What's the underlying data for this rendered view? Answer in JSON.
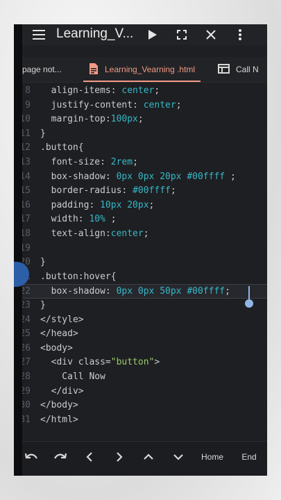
{
  "toolbar": {
    "title": "Learning_V...",
    "icons": [
      "menu-icon",
      "play-icon",
      "fullscreen-icon",
      "close-icon",
      "more-vertical-icon"
    ]
  },
  "tabs": [
    {
      "label": "page not...",
      "active": false
    },
    {
      "label": "Learning_Vearning .html",
      "active": true
    },
    {
      "label": "Call N",
      "active": false
    }
  ],
  "editor": {
    "lines": [
      {
        "n": "8",
        "t": "  align-items: center;"
      },
      {
        "n": "9",
        "t": "  justify-content: center;"
      },
      {
        "n": "10",
        "t": "  margin-top:100px;"
      },
      {
        "n": "11",
        "t": "}"
      },
      {
        "n": "12",
        "t": ".button{"
      },
      {
        "n": "13",
        "t": "  font-size: 2rem;"
      },
      {
        "n": "14",
        "t": "  box-shadow: 0px 0px 20px #00ffff ;"
      },
      {
        "n": "15",
        "t": "  border-radius: #00ffff;"
      },
      {
        "n": "16",
        "t": "  padding: 10px 20px;"
      },
      {
        "n": "17",
        "t": "  width: 10% ;"
      },
      {
        "n": "18",
        "t": "  text-align:center;"
      },
      {
        "n": "19",
        "t": ""
      },
      {
        "n": "20",
        "t": "}"
      },
      {
        "n": "21",
        "t": ".button:hover{"
      },
      {
        "n": "22",
        "t": "  box-shadow: 0px 0px 50px #00ffff;"
      },
      {
        "n": "23",
        "t": "}"
      },
      {
        "n": "24",
        "t": "</style>"
      },
      {
        "n": "25",
        "t": "</head>"
      },
      {
        "n": "26",
        "t": "<body>"
      },
      {
        "n": "27",
        "t": "  <div class=\"button\">"
      },
      {
        "n": "28",
        "t": "    Call Now"
      },
      {
        "n": "29",
        "t": "  </div>"
      },
      {
        "n": "30",
        "t": "</body>"
      },
      {
        "n": "31",
        "t": "</html>"
      }
    ],
    "current_line": "22"
  },
  "bottom": {
    "home_label": "Home",
    "end_label": "End",
    "icons": [
      "undo-icon",
      "redo-icon",
      "arrow-left-icon",
      "arrow-right-icon",
      "arrow-up-icon",
      "arrow-down-icon"
    ]
  },
  "colors": {
    "accent": "#f29a86",
    "value": "#35b9c8",
    "string": "#9cc96b"
  }
}
